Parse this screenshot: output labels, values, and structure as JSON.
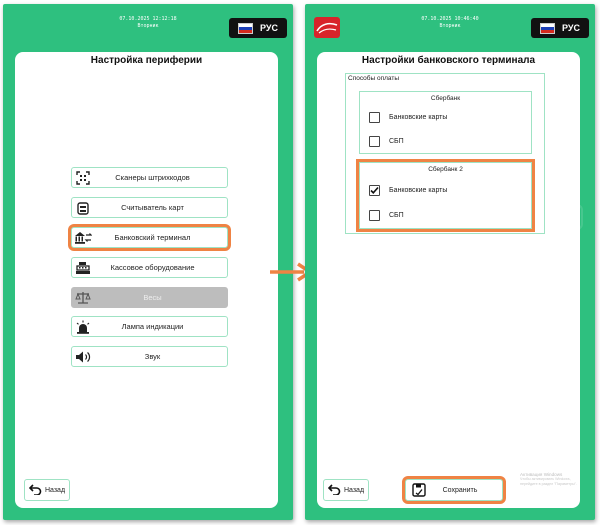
{
  "colors": {
    "brand_green": "#2ec07f",
    "panel_border": "#9fe3c4",
    "highlight_orange": "#ef8344",
    "disabled_gray": "#bdbdbd"
  },
  "left_screen": {
    "datetime": "07.10.2025 12:12:18",
    "weekday": "Вторник",
    "language": "РУС",
    "title": "Настройка периферии",
    "menu": [
      {
        "label": "Сканеры штрихкодов",
        "icon": "barcode-scanner-icon"
      },
      {
        "label": "Считыватель карт",
        "icon": "card-reader-icon"
      },
      {
        "label": "Банковский терминал",
        "icon": "bank-terminal-icon"
      },
      {
        "label": "Кассовое оборудование",
        "icon": "cash-register-icon"
      },
      {
        "label": "Весы",
        "icon": "scales-icon"
      },
      {
        "label": "Лампа индикации",
        "icon": "indicator-lamp-icon"
      },
      {
        "label": "Звук",
        "icon": "speaker-icon"
      }
    ],
    "back_label": "Назад"
  },
  "right_screen": {
    "datetime": "07.10.2025 10:46:40",
    "weekday": "Вторник",
    "language": "РУС",
    "title": "Настройки банковского терминала",
    "payment_group_label": "Способы оплаты",
    "groups": [
      {
        "name": "Сбербанк",
        "options": [
          {
            "label": "Банковские карты",
            "checked": false
          },
          {
            "label": "СБП",
            "checked": false
          }
        ]
      },
      {
        "name": "Сбербанк 2",
        "options": [
          {
            "label": "Банковские карты",
            "checked": true
          },
          {
            "label": "СБП",
            "checked": false
          }
        ]
      }
    ],
    "back_label": "Назад",
    "save_label": "Сохранить",
    "watermark_title": "Активация Windows",
    "watermark_text": "Чтобы активировать Windows, перейдите в раздел \"Параметры\"."
  }
}
